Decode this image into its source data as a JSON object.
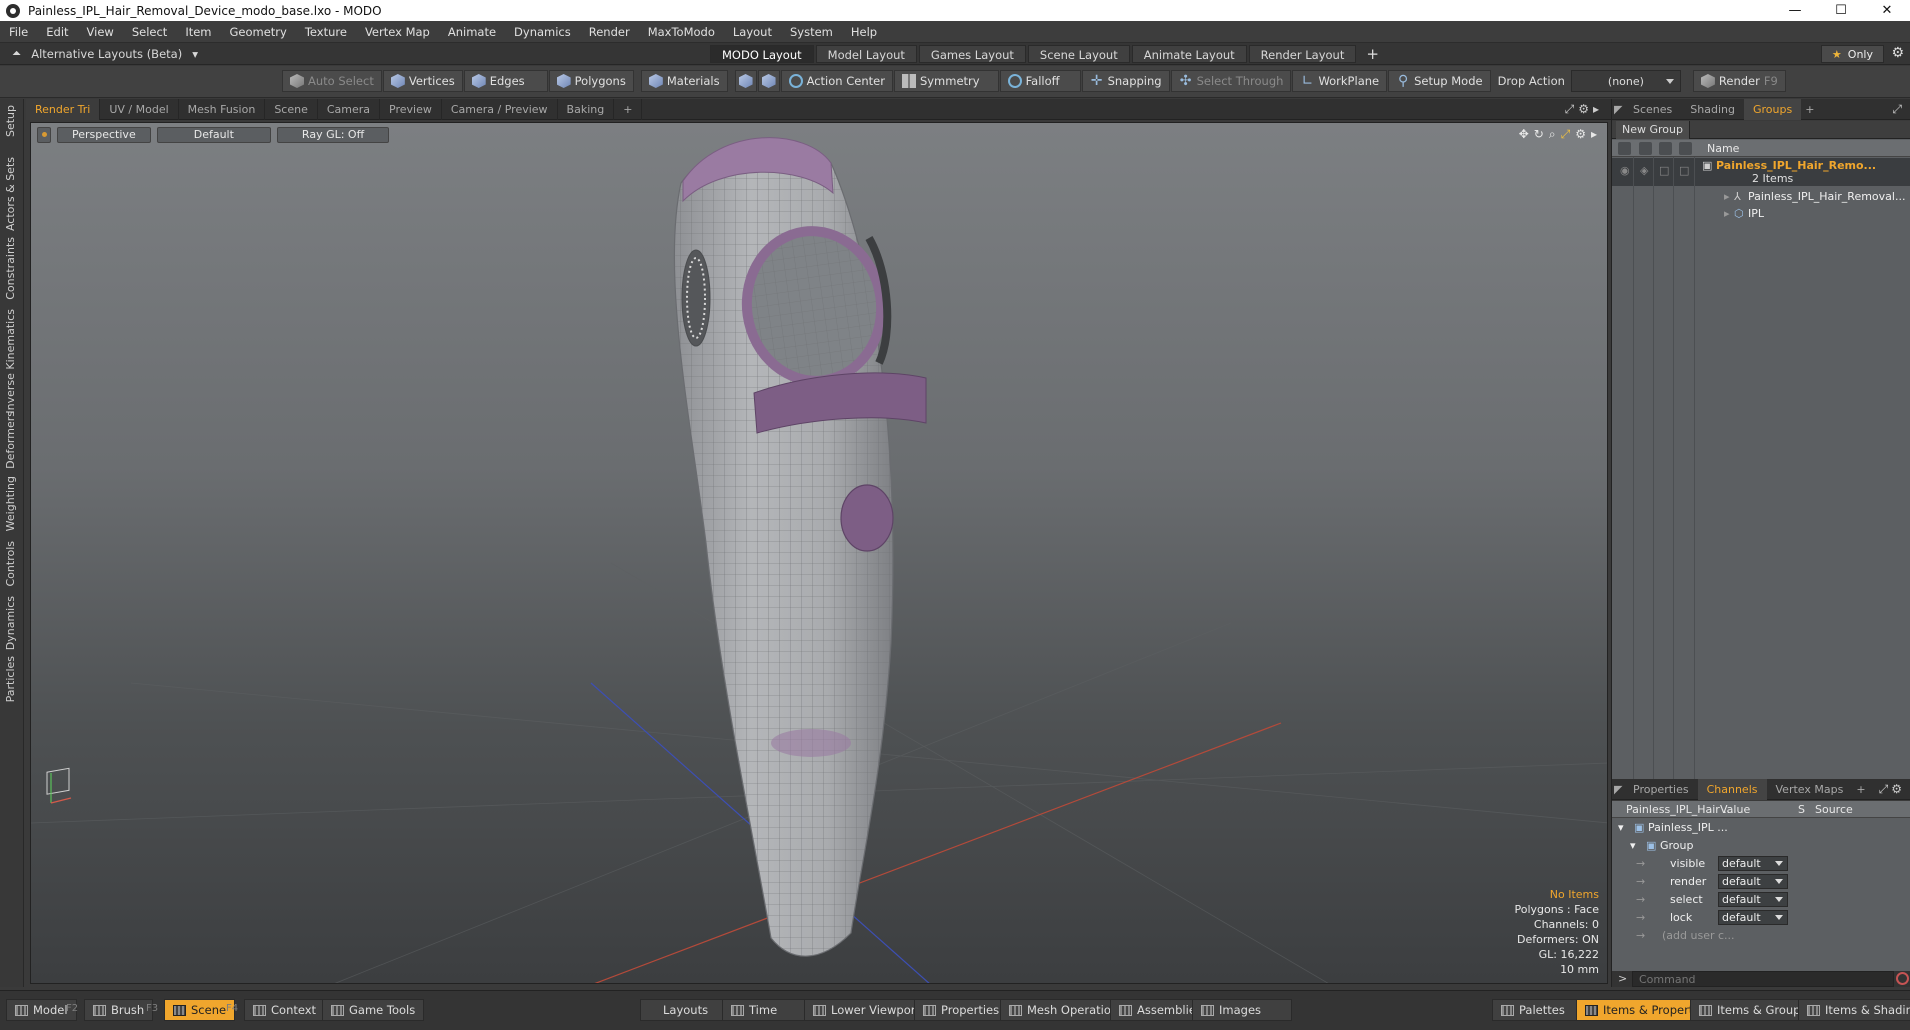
{
  "window": {
    "title": "Painless_IPL_Hair_Removal_Device_modo_base.lxo - MODO"
  },
  "menu": [
    "File",
    "Edit",
    "View",
    "Select",
    "Item",
    "Geometry",
    "Texture",
    "Vertex Map",
    "Animate",
    "Dynamics",
    "Render",
    "MaxToModo",
    "Layout",
    "System",
    "Help"
  ],
  "layoutbar": {
    "alt_layouts": "Alternative Layouts (Beta)",
    "tabs": [
      "MODO Layout",
      "Model Layout",
      "Games Layout",
      "Scene Layout",
      "Animate Layout",
      "Render Layout"
    ],
    "active_tab": "MODO Layout",
    "only_label": "Only"
  },
  "toolbar": {
    "auto_select": "Auto Select",
    "vertices": "Vertices",
    "edges": "Edges",
    "polygons": "Polygons",
    "materials": "Materials",
    "action_center": "Action Center",
    "symmetry": "Symmetry",
    "falloff": "Falloff",
    "snapping": "Snapping",
    "select_through": "Select Through",
    "workplane": "WorkPlane",
    "setup_mode": "Setup Mode",
    "drop_action": "Drop Action",
    "drop_value": "(none)",
    "render": "Render",
    "render_key": "F9"
  },
  "left_tabs": [
    "Setup",
    "Actors & Sets",
    "Constraints",
    "Inverse Kinematics",
    "Deformers",
    "Weighting",
    "Controls",
    "Dynamics",
    "Particles"
  ],
  "viewport_tabs": [
    "Render Tri",
    "UV / Model",
    "Mesh Fusion",
    "Scene",
    "Camera",
    "Preview",
    "Camera / Preview",
    "Baking"
  ],
  "viewport": {
    "view": "Perspective",
    "shading": "Default",
    "raygl": "Ray GL: Off",
    "info": {
      "items": "No Items",
      "polygons": "Polygons : Face",
      "channels": "Channels: 0",
      "deformers": "Deformers: ON",
      "gl": "GL: 16,222",
      "scale": "10 mm"
    }
  },
  "scene_panel": {
    "tabs": [
      "Scenes",
      "Shading",
      "Groups"
    ],
    "active_tab": "Groups",
    "new_group": "New Group",
    "col_name": "Name",
    "group_name": "Painless_IPL_Hair_Remo...",
    "group_count": "2 Items",
    "children": [
      "Painless_IPL_Hair_Removal...",
      "IPL"
    ]
  },
  "channels_panel": {
    "tabs": [
      "Properties",
      "Channels",
      "Vertex Maps"
    ],
    "active_tab": "Channels",
    "col_item": "Painless_IPL_Hair ...",
    "col_value": "Value",
    "col_s": "S",
    "col_source": "Source",
    "root": "Painless_IPL ...",
    "group": "Group",
    "rows": [
      {
        "label": "visible",
        "value": "default"
      },
      {
        "label": "render",
        "value": "default"
      },
      {
        "label": "select",
        "value": "default"
      },
      {
        "label": "lock",
        "value": "default"
      }
    ],
    "add_user": "(add user c...",
    "command_placeholder": "Command"
  },
  "bottombar": {
    "model": "Model",
    "model_key": "F2",
    "brush": "Brush",
    "brush_key": "F3",
    "scene": "Scene",
    "scene_key": "F4",
    "context": "Context",
    "game_tools": "Game Tools",
    "layouts": "Layouts",
    "time": "Time",
    "lower_viewports": "Lower Viewports",
    "properties": "Properties",
    "mesh_operations": "Mesh Operations",
    "assemblies": "Assemblies",
    "images": "Images",
    "palettes": "Palettes",
    "items_properties": "Items & Properties",
    "items_groups": "Items & Groups",
    "items_shading": "Items & Shading"
  },
  "colors": {
    "accent": "#f0a62d",
    "device_accent": "#8a6290"
  }
}
